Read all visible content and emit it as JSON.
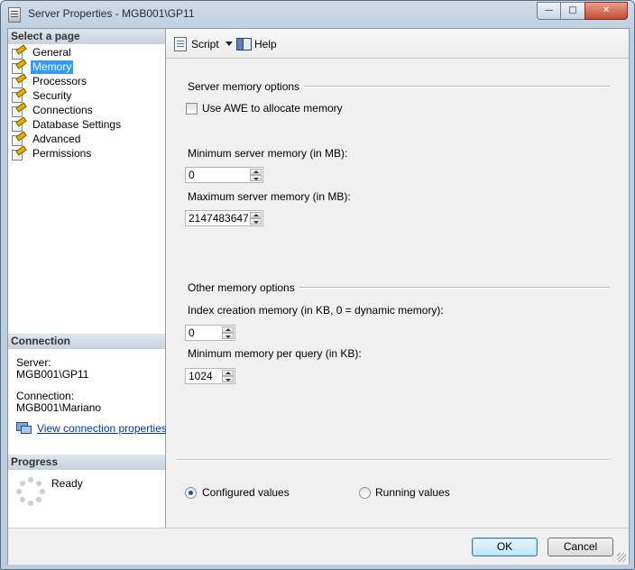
{
  "window": {
    "title": "Server Properties - MGB001\\GP11",
    "minimize_glyph": "—",
    "maximize_glyph": "□",
    "close_glyph": "✕"
  },
  "left_pane": {
    "select_page_header": "Select a page",
    "pages": [
      {
        "label": "General",
        "selected": false
      },
      {
        "label": "Memory",
        "selected": true
      },
      {
        "label": "Processors",
        "selected": false
      },
      {
        "label": "Security",
        "selected": false
      },
      {
        "label": "Connections",
        "selected": false
      },
      {
        "label": "Database Settings",
        "selected": false
      },
      {
        "label": "Advanced",
        "selected": false
      },
      {
        "label": "Permissions",
        "selected": false
      }
    ],
    "connection_header": "Connection",
    "server_label": "Server:",
    "server_value": "MGB001\\GP11",
    "connection_label": "Connection:",
    "connection_value": "MGB001\\Mariano",
    "view_connection_link": "View connection properties",
    "progress_header": "Progress",
    "progress_status": "Ready"
  },
  "toolbar": {
    "script_label": "Script",
    "help_label": "Help"
  },
  "memory": {
    "server_memory_group": "Server memory options",
    "use_awe_label": "Use AWE to allocate memory",
    "use_awe_checked": false,
    "min_server_memory_label": "Minimum server memory (in MB):",
    "min_server_memory_value": "0",
    "max_server_memory_label": "Maximum server memory (in MB):",
    "max_server_memory_value": "2147483647",
    "other_memory_group": "Other memory options",
    "index_creation_label": "Index creation memory (in KB, 0 = dynamic memory):",
    "index_creation_value": "0",
    "min_query_label": "Minimum memory per query (in KB):",
    "min_query_value": "1024",
    "configured_values_label": "Configured values",
    "running_values_label": "Running values",
    "selected_view": "Configured values"
  },
  "buttons": {
    "ok_label": "OK",
    "cancel_label": "Cancel"
  }
}
